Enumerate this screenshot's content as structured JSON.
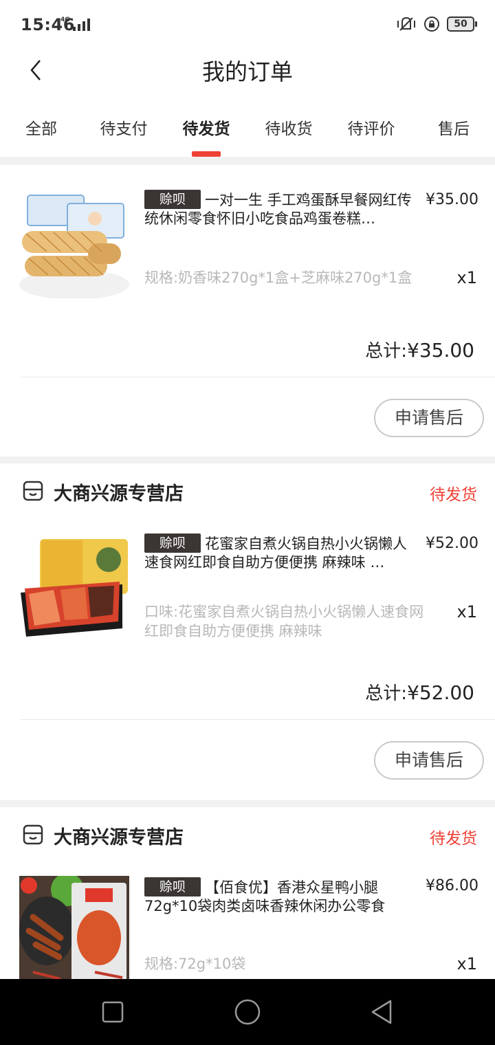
{
  "status_bar": {
    "time": "15:46",
    "network": "4G",
    "battery": "50"
  },
  "header": {
    "title": "我的订单",
    "back_icon": "chevron-left-icon"
  },
  "tabs": [
    {
      "label": "全部",
      "active": false
    },
    {
      "label": "待支付",
      "active": false
    },
    {
      "label": "待发货",
      "active": true
    },
    {
      "label": "待收货",
      "active": false
    },
    {
      "label": "待评价",
      "active": false
    },
    {
      "label": "售后",
      "active": false
    }
  ],
  "colors": {
    "accent": "#ef4035",
    "badge_bg": "#3b3533",
    "divider": "#f1f1f1"
  },
  "orders": [
    {
      "store": "",
      "status": "",
      "badge": "赊呗",
      "title": "一对一生 手工鸡蛋酥早餐网红传统休闲零食怀旧小吃食品鸡蛋卷糕…",
      "price": "¥35.00",
      "spec": "规格:奶香味270g*1盒+芝麻味270g*1盒",
      "qty": "x1",
      "total_label": "总计:",
      "total_value": "¥35.00",
      "action": "申请售后"
    },
    {
      "store": "大商兴源专营店",
      "status": "待发货",
      "badge": "赊呗",
      "title": "花蜜家自煮火锅自热小火锅懒人速食网红即食自助方便便携 麻辣味 …",
      "price": "¥52.00",
      "spec": "口味:花蜜家自煮火锅自热小火锅懒人速食网红即食自助方便便携 麻辣味",
      "qty": "x1",
      "total_label": "总计:",
      "total_value": "¥52.00",
      "action": "申请售后"
    },
    {
      "store": "大商兴源专营店",
      "status": "待发货",
      "badge": "赊呗",
      "title": "【佰食优】香港众星鸭小腿72g*10袋肉类卤味香辣休闲办公零食",
      "price": "¥86.00",
      "spec": "规格:72g*10袋",
      "qty": "x1"
    }
  ]
}
